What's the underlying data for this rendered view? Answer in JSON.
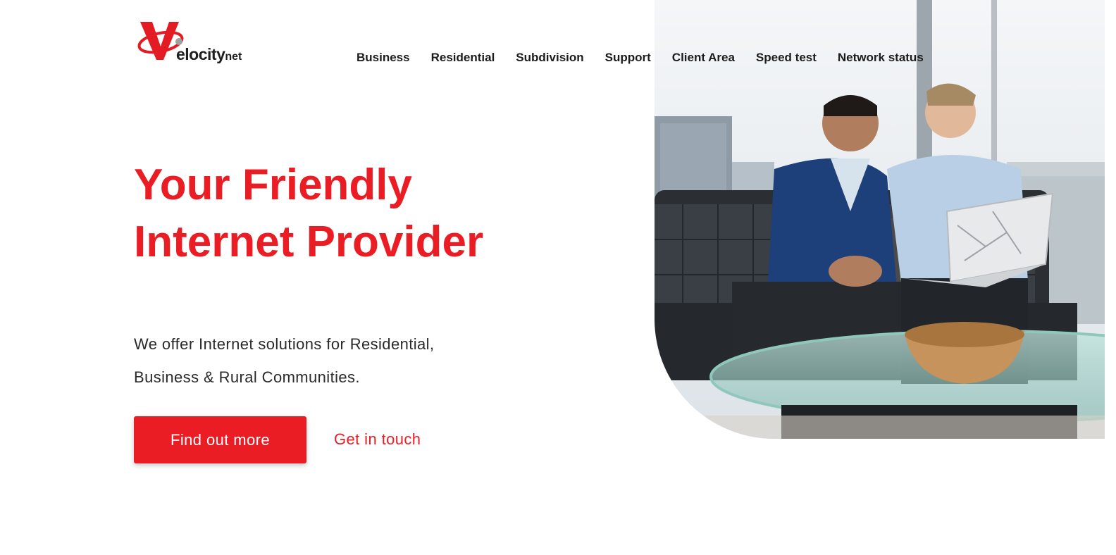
{
  "logo": {
    "letter": "V",
    "word": "elocity",
    "suffix": "net",
    "colors": {
      "red": "#e31b23",
      "dark": "#1f1f1f",
      "gray": "#a0a0a0"
    }
  },
  "nav": {
    "items": [
      {
        "label": "Business"
      },
      {
        "label": "Residential"
      },
      {
        "label": "Subdivision"
      },
      {
        "label": "Support"
      },
      {
        "label": "Client Area"
      },
      {
        "label": "Speed test"
      },
      {
        "label": "Network status"
      }
    ]
  },
  "hero": {
    "headline_line1": "Your Friendly",
    "headline_line2": "Internet Provider",
    "description_line1": "We offer Internet solutions for Residential,",
    "description_line2": "Business & Rural Communities.",
    "primary_button": "Find out more",
    "secondary_link": "Get in touch",
    "accent_color": "#ea1c24",
    "image_subject": "two-men-laptop-photo"
  }
}
